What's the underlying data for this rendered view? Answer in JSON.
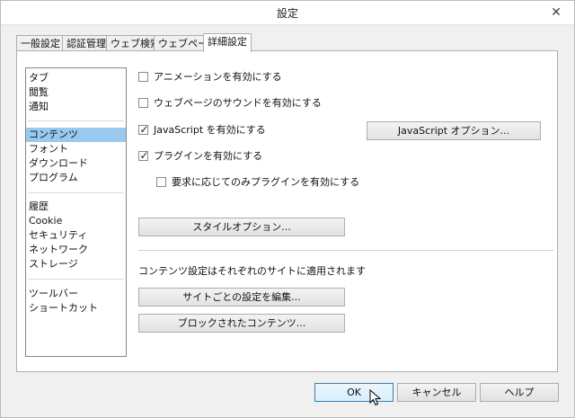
{
  "window": {
    "title": "設定",
    "close_glyph": "✕"
  },
  "tabs": [
    {
      "label": "一般設定"
    },
    {
      "label": "認証管理"
    },
    {
      "label": "ウェブ検索"
    },
    {
      "label": "ウェブページ"
    },
    {
      "label": "詳細設定",
      "active": true
    }
  ],
  "sidebar": {
    "items": [
      "タブ",
      "閲覧",
      "通知",
      "コンテンツ",
      "フォント",
      "ダウンロード",
      "プログラム",
      "履歴",
      "Cookie",
      "セキュリティ",
      "ネットワーク",
      "ストレージ",
      "ツールバー",
      "ショートカット"
    ],
    "selected": "コンテンツ"
  },
  "content": {
    "animation_label": "アニメーションを有効にする",
    "animation_checked": false,
    "sound_label": "ウェブページのサウンドを有効にする",
    "sound_checked": false,
    "javascript_label": "JavaScript を有効にする",
    "javascript_checked": true,
    "javascript_options_button": "JavaScript オプション...",
    "plugins_label": "プラグインを有効にする",
    "plugins_checked": true,
    "plugins_on_demand_label": "要求に応じてのみプラグインを有効にする",
    "plugins_on_demand_checked": false,
    "style_options_button": "スタイルオプション...",
    "site_note": "コンテンツ設定はそれぞれのサイトに適用されます",
    "edit_site_button": "サイトごとの設定を編集...",
    "blocked_content_button": "ブロックされたコンテンツ...",
    "check_glyph": "✓"
  },
  "footer": {
    "ok": "OK",
    "cancel": "キャンセル",
    "help": "ヘルプ"
  }
}
